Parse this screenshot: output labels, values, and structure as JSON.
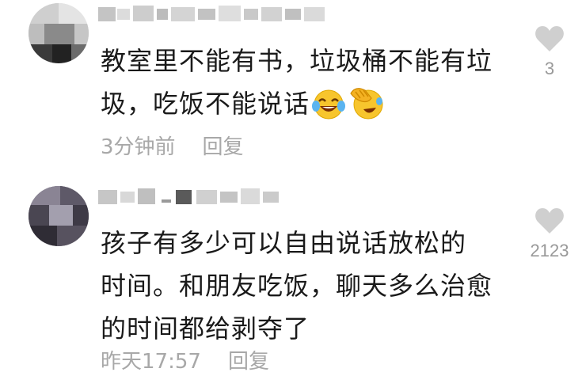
{
  "comments": [
    {
      "text_line1": "教室里不能有书，垃圾桶不能有垃",
      "text_line2": "圾，吃饭不能说话",
      "emojis": [
        "crying-laughing-emoji",
        "facepalm-laughing-emoji"
      ],
      "time": "3分钟前",
      "reply_label": "回复",
      "like_count": "3"
    },
    {
      "text_line1": "孩子有多少可以自由说话放松的",
      "text_line2": "时间。和朋友吃饭，聊天多么治愈",
      "text_line3": "的时间都给剥夺了",
      "time": "昨天17:57",
      "reply_label": "回复",
      "like_count": "2123"
    }
  ],
  "colors": {
    "text": "#1a1a1a",
    "meta": "#a8a8a8",
    "heart": "#cfcfcf",
    "count": "#999999"
  }
}
